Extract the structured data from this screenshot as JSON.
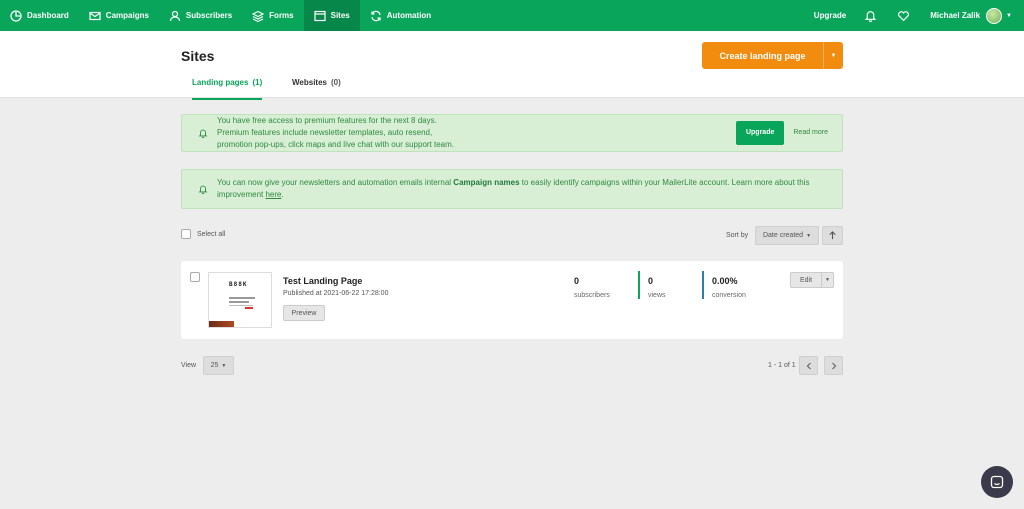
{
  "nav": {
    "items": [
      {
        "label": "Dashboard",
        "icon": "dashboard-icon"
      },
      {
        "label": "Campaigns",
        "icon": "envelope-icon"
      },
      {
        "label": "Subscribers",
        "icon": "user-icon"
      },
      {
        "label": "Forms",
        "icon": "layers-icon"
      },
      {
        "label": "Sites",
        "icon": "browser-icon"
      },
      {
        "label": "Automation",
        "icon": "refresh-icon"
      }
    ],
    "upgrade": "Upgrade",
    "user_name": "Michael Zalik"
  },
  "header": {
    "title": "Sites",
    "create_label": "Create landing page",
    "tabs": [
      {
        "label": "Landing pages",
        "count": "(1)"
      },
      {
        "label": "Websites",
        "count": "(0)"
      }
    ]
  },
  "alerts": {
    "premium": {
      "text": "You have free access to premium features for the next 8 days. Premium features include newsletter templates, auto resend, promotion pop-ups, click maps and live chat with our support team.",
      "upgrade": "Upgrade",
      "read_more": "Read more"
    },
    "campaign_names": {
      "before": "You can now give your newsletters and automation emails internal ",
      "bold": "Campaign names",
      "after": " to easily identify campaigns within your MailerLite account. Learn more about this improvement ",
      "link": "here",
      "end": "."
    }
  },
  "toolbar": {
    "select_all": "Select all",
    "sort_by": "Sort by",
    "sort_value": "Date created"
  },
  "landing_pages": [
    {
      "title": "Test Landing Page",
      "published": "Published at 2021-06-22 17:28:00",
      "preview": "Preview",
      "thumb_logo": "B88K",
      "stats": [
        {
          "value": "0",
          "label": "subscribers",
          "color": ""
        },
        {
          "value": "0",
          "label": "views",
          "color": "#09a55a"
        },
        {
          "value": "0.00%",
          "label": "conversion",
          "color": "#2f7fa8"
        }
      ],
      "edit": "Edit"
    }
  ],
  "pagination": {
    "view_label": "View",
    "per_page": "25",
    "info": "1 - 1 of 1"
  },
  "colors": {
    "brand": "#09a55a",
    "accent": "#f28c0f"
  }
}
